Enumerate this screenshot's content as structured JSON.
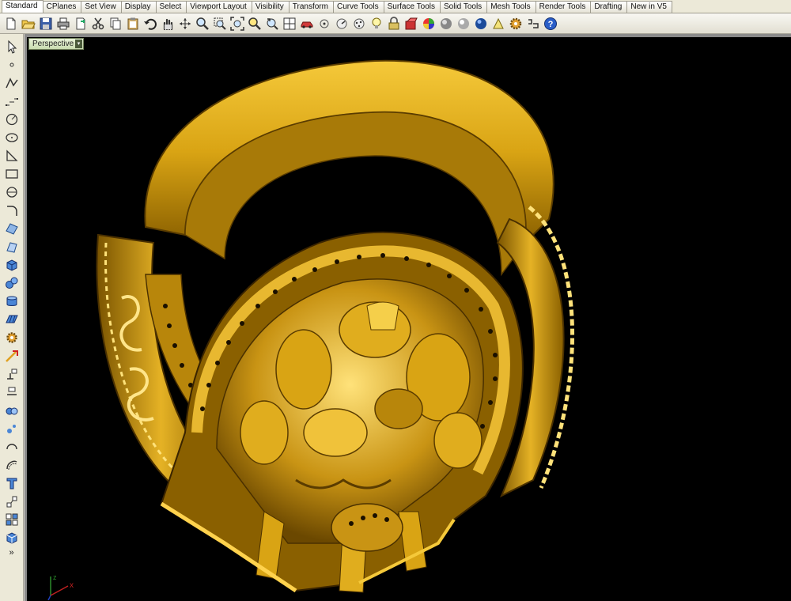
{
  "tabs": [
    {
      "label": "Standard",
      "active": true
    },
    {
      "label": "CPlanes"
    },
    {
      "label": "Set View"
    },
    {
      "label": "Display"
    },
    {
      "label": "Select"
    },
    {
      "label": "Viewport Layout"
    },
    {
      "label": "Visibility"
    },
    {
      "label": "Transform"
    },
    {
      "label": "Curve Tools"
    },
    {
      "label": "Surface Tools"
    },
    {
      "label": "Solid Tools"
    },
    {
      "label": "Mesh Tools"
    },
    {
      "label": "Render Tools"
    },
    {
      "label": "Drafting"
    },
    {
      "label": "New in V5"
    }
  ],
  "viewport": {
    "label": "Perspective",
    "menu_arrow": "▾",
    "axis_x": "x",
    "axis_z": "z",
    "background": "#000000"
  },
  "left_toolbar": {
    "more_label": "»"
  },
  "colors": {
    "gold": "#e0b21c",
    "gold_dark": "#8a6400",
    "gold_light": "#ffe070"
  }
}
